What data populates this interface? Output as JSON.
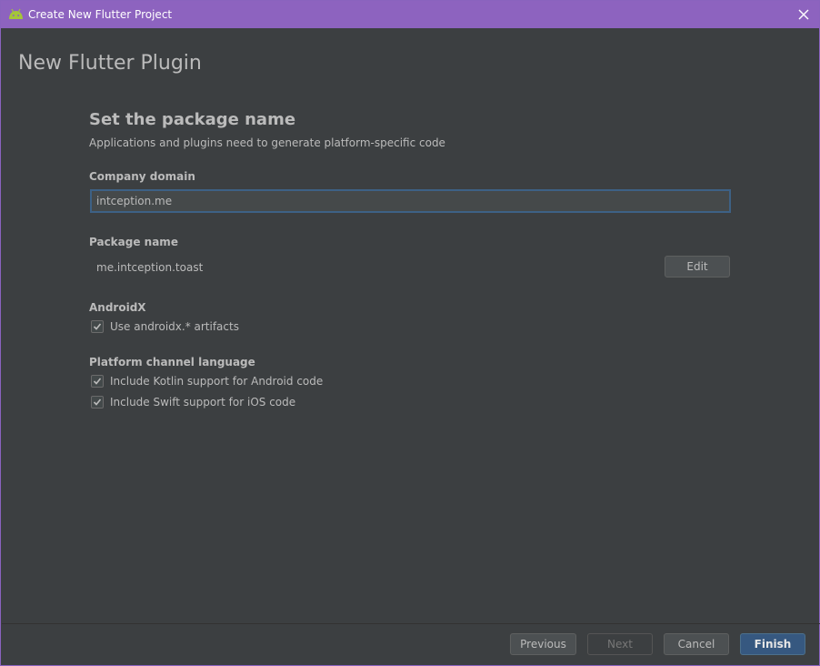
{
  "window": {
    "title": "Create New Flutter Project",
    "app_icon": "android-icon",
    "close_icon": "close-icon"
  },
  "header": {
    "title": "New Flutter Plugin"
  },
  "section": {
    "title": "Set the package name",
    "description": "Applications and plugins need to generate platform-specific code"
  },
  "company_domain": {
    "label": "Company domain",
    "value": "intception.me"
  },
  "package_name": {
    "label": "Package name",
    "value": "me.intception.toast",
    "edit_label": "Edit"
  },
  "androidx": {
    "label": "AndroidX",
    "use_androidx_label": "Use androidx.* artifacts",
    "use_androidx_checked": true
  },
  "platform_channel": {
    "label": "Platform channel language",
    "kotlin_label": "Include Kotlin support for Android code",
    "kotlin_checked": true,
    "swift_label": "Include Swift support for iOS code",
    "swift_checked": true
  },
  "footer": {
    "previous_label": "Previous",
    "next_label": "Next",
    "cancel_label": "Cancel",
    "finish_label": "Finish"
  },
  "colors": {
    "titlebar": "#8d63bf",
    "background": "#3c3f41",
    "primary_button": "#365880",
    "focus_border": "#3d6185"
  }
}
